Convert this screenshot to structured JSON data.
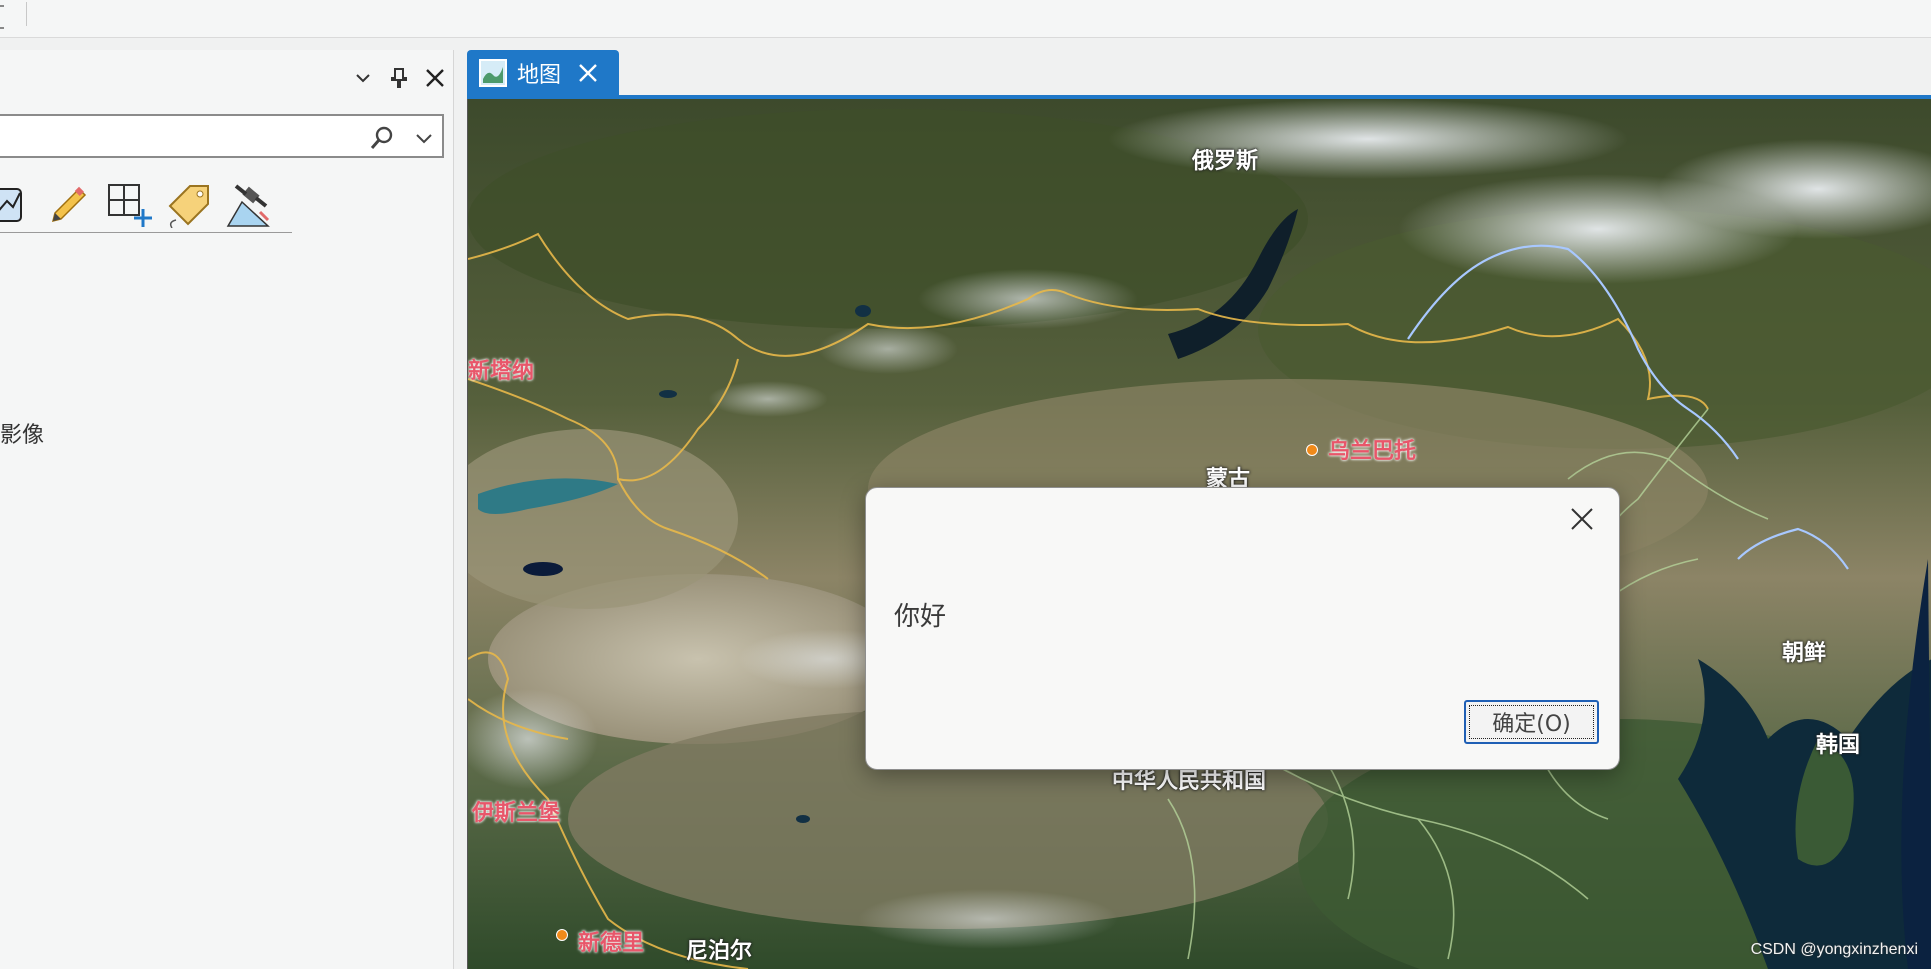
{
  "top_ribbon": {},
  "left_pane": {
    "search": {
      "value": "",
      "placeholder": ""
    },
    "icons": [
      "chart-icon",
      "pencil-icon",
      "grid-add-icon",
      "tag-icon",
      "satellite-icon"
    ],
    "image_label": "影像"
  },
  "map_tab": {
    "label": "地图"
  },
  "map": {
    "labels": {
      "russia": "俄罗斯",
      "astana": "新塔纳",
      "ulaanbaatar": "乌兰巴托",
      "mongolia": "蒙古",
      "north_korea": "朝鲜",
      "south_korea": "韩国",
      "china": "中华人民共和国",
      "islamabad": "伊斯兰堡",
      "new_delhi": "新德里",
      "nepal": "尼泊尔"
    },
    "watermark": "CSDN @yongxinzhenxi",
    "colors": {
      "border": "#e8b84a",
      "river": "#a8c8ff",
      "province": "#b5d39a"
    }
  },
  "dialog": {
    "message": "你好",
    "ok_label": "确定(O)"
  },
  "colors": {
    "accent": "#1f78c8",
    "button_focus": "#1f5fb5"
  }
}
